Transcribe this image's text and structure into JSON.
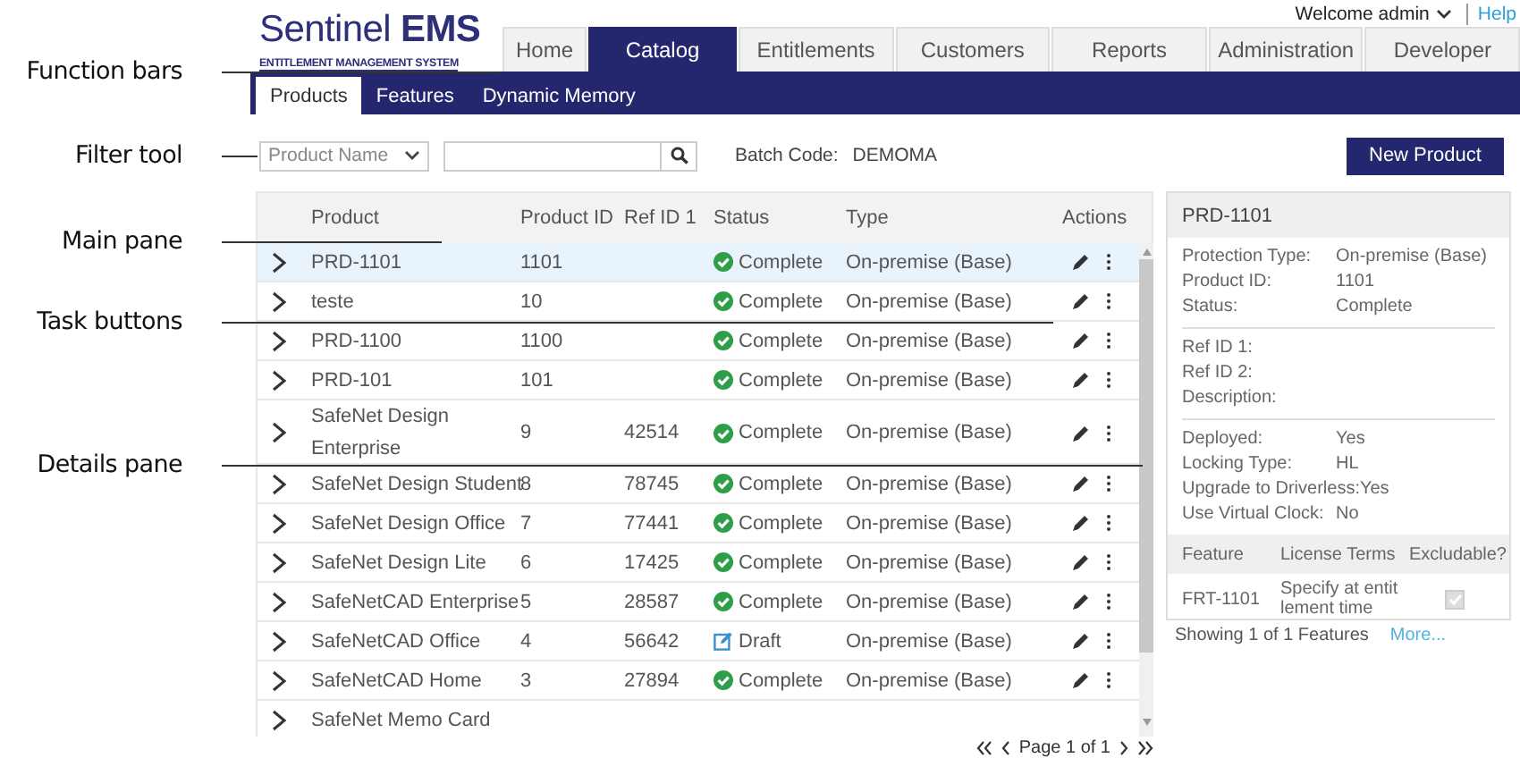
{
  "annotations": [
    {
      "text": "Function bars"
    },
    {
      "text": "Filter tool"
    },
    {
      "text": "Main pane"
    },
    {
      "text": "Task buttons"
    },
    {
      "text": "Details pane"
    }
  ],
  "header": {
    "logo": "Sentinel **EMS**",
    "tagline": "ENTITLEMENT MANAGEMENT SYSTEM",
    "welcome": "Welcome admin",
    "help": "Help"
  },
  "nav_tabs": [
    {
      "label": "Home",
      "selected": false
    },
    {
      "label": "Catalog",
      "selected": true
    },
    {
      "label": "Entitlements",
      "selected": false
    },
    {
      "label": "Customers",
      "selected": false
    },
    {
      "label": "Reports",
      "selected": false
    },
    {
      "label": "Administration",
      "selected": false
    },
    {
      "label": "Developer",
      "selected": false
    }
  ],
  "sub_tabs": [
    {
      "label": "Products",
      "selected": true
    },
    {
      "label": "Features",
      "selected": false
    },
    {
      "label": "Dynamic Memory",
      "selected": false
    }
  ],
  "filter": {
    "dropdown": "Product Name",
    "batch_label": "Batch Code:",
    "batch_value": "DEMOMA",
    "new_button": "New Product"
  },
  "table": {
    "columns": [
      "Product",
      "Product ID",
      "Ref ID 1",
      "Status",
      "Type",
      "Actions"
    ],
    "rows": [
      {
        "product": "PRD-1101",
        "product_id": "1101",
        "ref_id_1": "",
        "status": {
          "kind": "complete",
          "text": "Complete"
        },
        "type": "On-premise (Base)",
        "selected": true
      },
      {
        "product": "teste",
        "product_id": "10",
        "ref_id_1": "",
        "status": {
          "kind": "complete",
          "text": "Complete"
        },
        "type": "On-premise (Base)",
        "selected": false
      },
      {
        "product": "PRD-1100",
        "product_id": "1100",
        "ref_id_1": "",
        "status": {
          "kind": "complete",
          "text": "Complete"
        },
        "type": "On-premise (Base)",
        "selected": false
      },
      {
        "product": "PRD-101",
        "product_id": "101",
        "ref_id_1": "",
        "status": {
          "kind": "complete",
          "text": "Complete"
        },
        "type": "On-premise (Base)",
        "selected": false
      },
      {
        "product": "SafeNet Design Enterprise",
        "product_id": "9",
        "ref_id_1": "42514",
        "status": {
          "kind": "complete",
          "text": "Complete"
        },
        "type": "On-premise (Base)",
        "selected": false
      },
      {
        "product": "SafeNet Design Student",
        "product_id": "8",
        "ref_id_1": "78745",
        "status": {
          "kind": "complete",
          "text": "Complete"
        },
        "type": "On-premise (Base)",
        "selected": false
      },
      {
        "product": "SafeNet Design Office",
        "product_id": "7",
        "ref_id_1": "77441",
        "status": {
          "kind": "complete",
          "text": "Complete"
        },
        "type": "On-premise (Base)",
        "selected": false
      },
      {
        "product": "SafeNet Design Lite",
        "product_id": "6",
        "ref_id_1": "17425",
        "status": {
          "kind": "complete",
          "text": "Complete"
        },
        "type": "On-premise (Base)",
        "selected": false
      },
      {
        "product": "SafeNetCAD Enterprise",
        "product_id": "5",
        "ref_id_1": "28587",
        "status": {
          "kind": "complete",
          "text": "Complete"
        },
        "type": "On-premise (Base)",
        "selected": false
      },
      {
        "product": "SafeNetCAD Office",
        "product_id": "4",
        "ref_id_1": "56642",
        "status": {
          "kind": "draft",
          "text": "Draft"
        },
        "type": "On-premise (Base)",
        "selected": false
      },
      {
        "product": "SafeNetCAD Home",
        "product_id": "3",
        "ref_id_1": "27894",
        "status": {
          "kind": "complete",
          "text": "Complete"
        },
        "type": "On-premise (Base)",
        "selected": false
      },
      {
        "product": "SafeNet Memo Card",
        "selected": false
      }
    ],
    "pagination": "Page 1 of 1"
  },
  "details": {
    "title": "PRD-1101",
    "groups": [
      [
        {
          "label": "Protection Type:",
          "value": "On-premise (Base)"
        },
        {
          "label": "Product ID:",
          "value": "1101"
        },
        {
          "label": "Status:",
          "value": "Complete"
        }
      ],
      [
        {
          "label": "Ref ID 1:"
        },
        {
          "label": "Ref ID 2:"
        },
        {
          "label": "Description:"
        }
      ],
      [
        {
          "label": "Deployed:",
          "value": "Yes"
        },
        {
          "label": "Locking Type:",
          "value": "HL"
        },
        {
          "label": "Upgrade to Driverless:",
          "value": "Yes"
        },
        {
          "label": "Use Virtual Clock:",
          "value": "No"
        }
      ]
    ],
    "features": {
      "columns": [
        "Feature",
        "License Terms",
        "Excludable?"
      ],
      "rows": [
        {
          "feature": "FRT-1101",
          "license_terms": "Specify at entitlement time",
          "excludable": {
            "checked": true,
            "disabled": true
          }
        }
      ]
    },
    "footer": "Showing 1 of 1 Features",
    "more_link": "More..."
  }
}
